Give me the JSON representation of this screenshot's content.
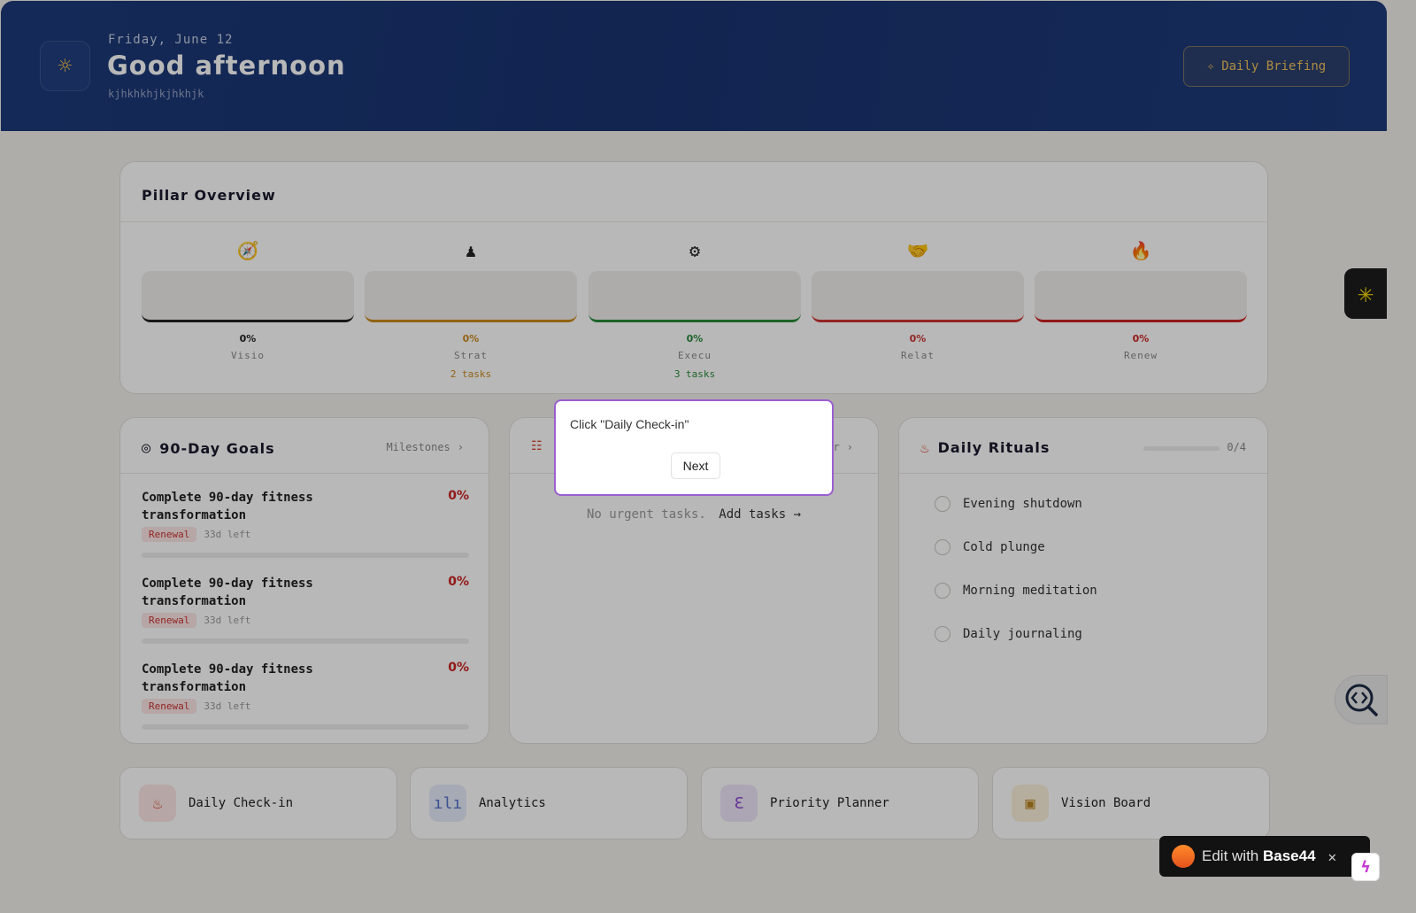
{
  "header": {
    "date": "Friday, June 12",
    "greeting": "Good afternoon",
    "subtitle": "kjhkhkhjkjhkhjk",
    "briefing_label": "Daily Briefing"
  },
  "pillars": {
    "title": "Pillar Overview",
    "items": [
      {
        "icon": "🧭",
        "percent": "0%",
        "name": "Visio",
        "tasks": "",
        "color": "#222222"
      },
      {
        "icon": "♟",
        "percent": "0%",
        "name": "Strat",
        "tasks": "2 tasks",
        "color": "#c98a1c"
      },
      {
        "icon": "⚙",
        "percent": "0%",
        "name": "Execu",
        "tasks": "3 tasks",
        "color": "#2a8a3a"
      },
      {
        "icon": "🤝",
        "percent": "0%",
        "name": "Relat",
        "tasks": "",
        "color": "#cc3333"
      },
      {
        "icon": "🔥",
        "percent": "0%",
        "name": "Renew",
        "tasks": "",
        "color": "#cc2222"
      }
    ]
  },
  "goals": {
    "title": "90-Day Goals",
    "link": "Milestones",
    "items": [
      {
        "title": "Complete 90-day fitness transformation",
        "percent": "0%",
        "pillar": "Renewal",
        "days_left": "33d left",
        "progress": 0
      },
      {
        "title": "Complete 90-day fitness transformation",
        "percent": "0%",
        "pillar": "Renewal",
        "days_left": "33d left",
        "progress": 0
      },
      {
        "title": "Complete 90-day fitness transformation",
        "percent": "0%",
        "pillar": "Renewal",
        "days_left": "33d left",
        "progress": 0
      }
    ]
  },
  "tasks": {
    "header_tail": "r",
    "empty_text": "No urgent tasks.",
    "add_link": "Add tasks →"
  },
  "rituals": {
    "title": "Daily Rituals",
    "count": "0/4",
    "progress": 0,
    "items": [
      "Evening shutdown",
      "Cold plunge",
      "Morning meditation",
      "Daily journaling"
    ]
  },
  "quick_links": [
    {
      "label": "Daily Check-in",
      "icon": "flame-icon",
      "glyph": "♨",
      "bg": "#fde8e6",
      "fg": "#d8452e"
    },
    {
      "label": "Analytics",
      "icon": "bar-chart-icon",
      "glyph": "ılı",
      "bg": "#e6ecfb",
      "fg": "#5470c8"
    },
    {
      "label": "Priority Planner",
      "icon": "brain-icon",
      "glyph": "ℇ",
      "bg": "#efe6fa",
      "fg": "#8a4bd0"
    },
    {
      "label": "Vision Board",
      "icon": "image-icon",
      "glyph": "▣",
      "bg": "#fbf1dc",
      "fg": "#b8821c"
    }
  ],
  "tooltip": {
    "text": "Click \"Daily Check-in\"",
    "next_label": "Next"
  },
  "base44": {
    "prefix": "Edit with",
    "brand": "Base44"
  }
}
